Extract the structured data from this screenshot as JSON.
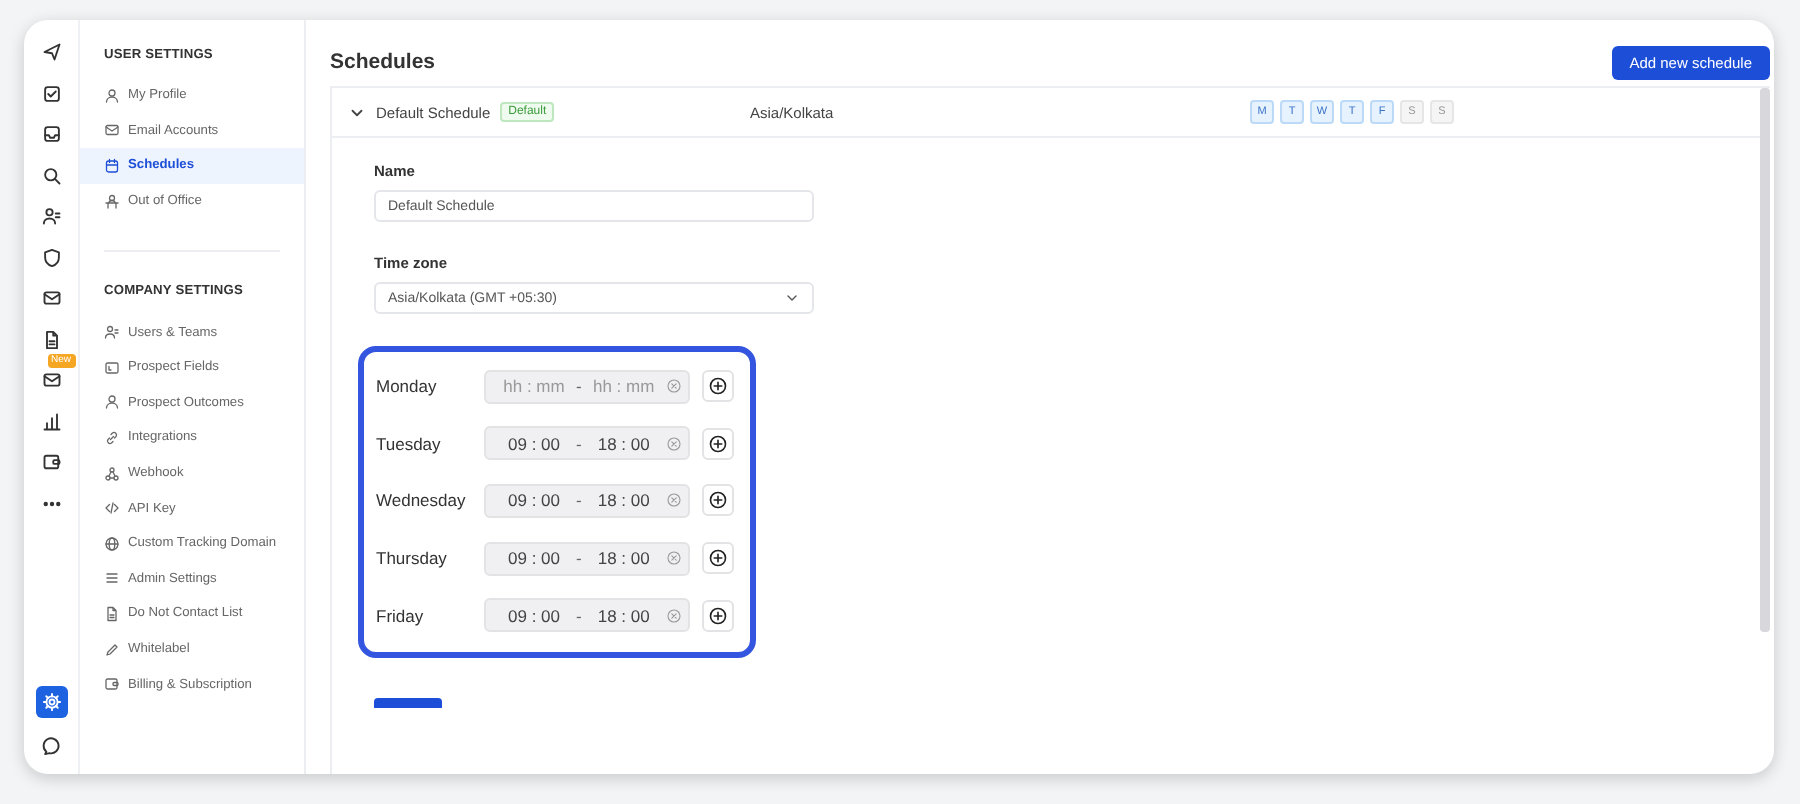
{
  "rail": {
    "items": [
      {
        "selected": false
      },
      {
        "selected": false
      },
      {
        "selected": false
      },
      {
        "selected": false
      },
      {
        "selected": false
      },
      {
        "selected": false
      },
      {
        "selected": false
      },
      {
        "selected": false
      },
      {
        "selected": false,
        "badge": "New"
      },
      {
        "selected": false
      },
      {
        "selected": false
      },
      {
        "selected": false
      }
    ],
    "bottom": [
      {
        "selected": true
      },
      {
        "selected": false
      }
    ]
  },
  "sidebar": {
    "sections": [
      {
        "heading": "USER SETTINGS",
        "items": [
          {
            "label": "My Profile",
            "selected": false
          },
          {
            "label": "Email Accounts",
            "selected": false
          },
          {
            "label": "Schedules",
            "selected": true
          },
          {
            "label": "Out of Office",
            "selected": false
          }
        ]
      },
      {
        "heading": "COMPANY SETTINGS",
        "items": [
          {
            "label": "Users & Teams",
            "selected": false
          },
          {
            "label": "Prospect Fields",
            "selected": false
          },
          {
            "label": "Prospect Outcomes",
            "selected": false
          },
          {
            "label": "Integrations",
            "selected": false
          },
          {
            "label": "Webhook",
            "selected": false
          },
          {
            "label": "API Key",
            "selected": false
          },
          {
            "label": "Custom Tracking Domain",
            "selected": false
          },
          {
            "label": "Admin Settings",
            "selected": false
          },
          {
            "label": "Do Not Contact List",
            "selected": false
          },
          {
            "label": "Whitelabel",
            "selected": false
          },
          {
            "label": "Billing & Subscription",
            "selected": false
          }
        ]
      }
    ]
  },
  "page": {
    "title": "Schedules",
    "add_button": "Add new schedule"
  },
  "schedule": {
    "name": "Default Schedule",
    "badge": "Default",
    "timezone": "Asia/Kolkata",
    "expanded": true,
    "weekdays": [
      {
        "label": "M",
        "selected": true
      },
      {
        "label": "T",
        "selected": true
      },
      {
        "label": "W",
        "selected": true
      },
      {
        "label": "T",
        "selected": true
      },
      {
        "label": "F",
        "selected": true
      },
      {
        "label": "S",
        "selected": false
      },
      {
        "label": "S",
        "selected": false
      }
    ],
    "name_label": "Name",
    "name_value": "Default Schedule",
    "timezone_label": "Time zone",
    "timezone_value": "Asia/Kolkata (GMT +05:30)",
    "days": [
      {
        "day": "Monday",
        "start": {
          "placeholder": "hh : mm"
        },
        "separator": "-",
        "end": {
          "placeholder": "hh : mm"
        }
      },
      {
        "day": "Tuesday",
        "start": {
          "value": "09 : 00"
        },
        "separator": "-",
        "end": {
          "value": "18 : 00"
        }
      },
      {
        "day": "Wednesday",
        "start": {
          "value": "09 : 00"
        },
        "separator": "-",
        "end": {
          "value": "18 : 00"
        }
      },
      {
        "day": "Thursday",
        "start": {
          "value": "09 : 00"
        },
        "separator": "-",
        "end": {
          "value": "18 : 00"
        }
      },
      {
        "day": "Friday",
        "start": {
          "value": "09 : 00"
        },
        "separator": "-",
        "end": {
          "value": "18 : 00"
        }
      }
    ]
  }
}
